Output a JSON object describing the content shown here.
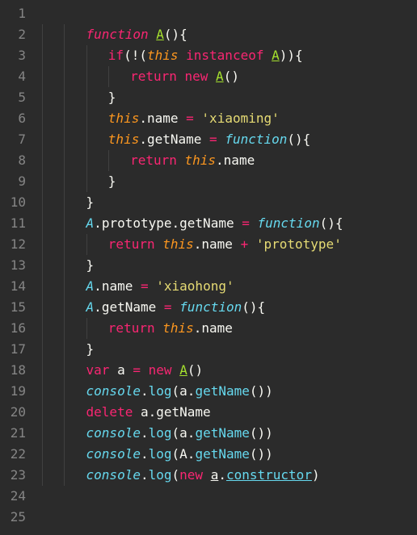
{
  "editor": {
    "first_line": 1,
    "last_line": 25,
    "lines": {
      "1": "",
      "2": {
        "indent": 2,
        "tokens": [
          [
            "kw",
            "function"
          ],
          [
            "white",
            " "
          ],
          [
            "fnname",
            "A"
          ],
          [
            "p",
            "(){"
          ]
        ]
      },
      "3": {
        "indent": 3,
        "tokens": [
          [
            "kw2",
            "if"
          ],
          [
            "p",
            "(!("
          ],
          [
            "this",
            "this"
          ],
          [
            "white",
            " "
          ],
          [
            "kw2",
            "instanceof"
          ],
          [
            "white",
            " "
          ],
          [
            "fnname",
            "A"
          ],
          [
            "p",
            ")){"
          ]
        ]
      },
      "4": {
        "indent": 4,
        "tokens": [
          [
            "kw2",
            "return"
          ],
          [
            "white",
            " "
          ],
          [
            "kw2",
            "new"
          ],
          [
            "white",
            " "
          ],
          [
            "fnname",
            "A"
          ],
          [
            "p",
            "()"
          ]
        ]
      },
      "5": {
        "indent": 3,
        "tokens": [
          [
            "p",
            "}"
          ]
        ]
      },
      "6": {
        "indent": 3,
        "tokens": [
          [
            "this",
            "this"
          ],
          [
            "white",
            "."
          ],
          [
            "prop",
            "name"
          ],
          [
            "white",
            " "
          ],
          [
            "op",
            "="
          ],
          [
            "white",
            " "
          ],
          [
            "str",
            "'xiaoming'"
          ]
        ]
      },
      "7": {
        "indent": 3,
        "tokens": [
          [
            "this",
            "this"
          ],
          [
            "white",
            "."
          ],
          [
            "prop",
            "getName"
          ],
          [
            "white",
            " "
          ],
          [
            "op",
            "="
          ],
          [
            "white",
            " "
          ],
          [
            "fnword",
            "function"
          ],
          [
            "p",
            "(){"
          ]
        ]
      },
      "8": {
        "indent": 4,
        "tokens": [
          [
            "kw2",
            "return"
          ],
          [
            "white",
            " "
          ],
          [
            "this",
            "this"
          ],
          [
            "white",
            "."
          ],
          [
            "prop",
            "name"
          ]
        ]
      },
      "9": {
        "indent": 3,
        "tokens": [
          [
            "p",
            "}"
          ]
        ]
      },
      "10": {
        "indent": 2,
        "tokens": [
          [
            "p",
            "}"
          ]
        ]
      },
      "11": {
        "indent": 2,
        "tokens": [
          [
            "id",
            "A"
          ],
          [
            "white",
            "."
          ],
          [
            "prop",
            "prototype"
          ],
          [
            "white",
            "."
          ],
          [
            "prop",
            "getName"
          ],
          [
            "white",
            " "
          ],
          [
            "op",
            "="
          ],
          [
            "white",
            " "
          ],
          [
            "fnword",
            "function"
          ],
          [
            "p",
            "(){"
          ]
        ]
      },
      "12": {
        "indent": 3,
        "tokens": [
          [
            "kw2",
            "return"
          ],
          [
            "white",
            " "
          ],
          [
            "this",
            "this"
          ],
          [
            "white",
            "."
          ],
          [
            "prop",
            "name"
          ],
          [
            "white",
            " "
          ],
          [
            "op",
            "+"
          ],
          [
            "white",
            " "
          ],
          [
            "str",
            "'prototype'"
          ]
        ]
      },
      "13": {
        "indent": 2,
        "tokens": [
          [
            "p",
            "}"
          ]
        ]
      },
      "14": {
        "indent": 2,
        "tokens": [
          [
            "id",
            "A"
          ],
          [
            "white",
            "."
          ],
          [
            "prop",
            "name"
          ],
          [
            "white",
            " "
          ],
          [
            "op",
            "="
          ],
          [
            "white",
            " "
          ],
          [
            "str",
            "'xiaohong'"
          ]
        ]
      },
      "15": {
        "indent": 2,
        "tokens": [
          [
            "id",
            "A"
          ],
          [
            "white",
            "."
          ],
          [
            "prop",
            "getName"
          ],
          [
            "white",
            " "
          ],
          [
            "op",
            "="
          ],
          [
            "white",
            " "
          ],
          [
            "fnword",
            "function"
          ],
          [
            "p",
            "(){"
          ]
        ]
      },
      "16": {
        "indent": 3,
        "tokens": [
          [
            "kw2",
            "return"
          ],
          [
            "white",
            " "
          ],
          [
            "this",
            "this"
          ],
          [
            "white",
            "."
          ],
          [
            "prop",
            "name"
          ]
        ]
      },
      "17": {
        "indent": 2,
        "tokens": [
          [
            "p",
            "}"
          ]
        ]
      },
      "18": {
        "indent": 2,
        "tokens": [
          [
            "kw2",
            "var"
          ],
          [
            "white",
            " "
          ],
          [
            "prop",
            "a"
          ],
          [
            "white",
            " "
          ],
          [
            "op",
            "="
          ],
          [
            "white",
            " "
          ],
          [
            "kw2",
            "new"
          ],
          [
            "white",
            " "
          ],
          [
            "fnname",
            "A"
          ],
          [
            "p",
            "()"
          ]
        ]
      },
      "19": {
        "indent": 2,
        "tokens": [
          [
            "id",
            "console"
          ],
          [
            "white",
            "."
          ],
          [
            "call",
            "log"
          ],
          [
            "p",
            "("
          ],
          [
            "prop",
            "a"
          ],
          [
            "white",
            "."
          ],
          [
            "call",
            "getName"
          ],
          [
            "p",
            "())"
          ]
        ]
      },
      "20": {
        "indent": 2,
        "tokens": [
          [
            "kw2",
            "delete"
          ],
          [
            "white",
            " "
          ],
          [
            "prop",
            "a"
          ],
          [
            "white",
            "."
          ],
          [
            "prop",
            "getName"
          ]
        ]
      },
      "21": {
        "indent": 2,
        "tokens": [
          [
            "id",
            "console"
          ],
          [
            "white",
            "."
          ],
          [
            "call",
            "log"
          ],
          [
            "p",
            "("
          ],
          [
            "prop",
            "a"
          ],
          [
            "white",
            "."
          ],
          [
            "call",
            "getName"
          ],
          [
            "p",
            "())"
          ]
        ]
      },
      "22": {
        "indent": 2,
        "tokens": [
          [
            "id",
            "console"
          ],
          [
            "white",
            "."
          ],
          [
            "call",
            "log"
          ],
          [
            "p",
            "("
          ],
          [
            "prop",
            "A"
          ],
          [
            "white",
            "."
          ],
          [
            "call",
            "getName"
          ],
          [
            "p",
            "())"
          ]
        ]
      },
      "23": {
        "indent": 2,
        "tokens": [
          [
            "id",
            "console"
          ],
          [
            "white",
            "."
          ],
          [
            "call",
            "log"
          ],
          [
            "p",
            "("
          ],
          [
            "kw2",
            "new"
          ],
          [
            "white",
            " "
          ],
          [
            "underline prop",
            "a"
          ],
          [
            "white",
            "."
          ],
          [
            "underline call",
            "constructor"
          ],
          [
            "p",
            ")"
          ]
        ]
      },
      "24": "",
      "25": ""
    }
  }
}
